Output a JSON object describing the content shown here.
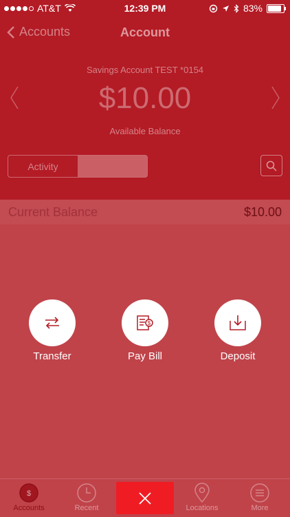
{
  "status": {
    "carrier": "AT&T",
    "time": "12:39 PM",
    "battery": "83%"
  },
  "nav": {
    "back_label": "Accounts",
    "title": "Account"
  },
  "account": {
    "name": "Savings Account TEST *0154",
    "balance": "$10.00",
    "balance_label": "Available Balance"
  },
  "segments": [
    "Activity",
    ""
  ],
  "current_balance": {
    "label": "Current Balance",
    "value": "$10.00"
  },
  "actions": [
    {
      "label": "Transfer",
      "icon": "transfer-arrows-icon"
    },
    {
      "label": "Pay Bill",
      "icon": "bill-icon"
    },
    {
      "label": "Deposit",
      "icon": "deposit-tray-icon"
    }
  ],
  "tabs": [
    {
      "label": "Accounts",
      "icon": "dollar-circle-icon",
      "active": true
    },
    {
      "label": "Recent",
      "icon": "clock-icon",
      "active": false
    },
    {
      "label": "Locations",
      "icon": "location-pin-icon",
      "active": false
    },
    {
      "label": "More",
      "icon": "menu-icon",
      "active": false
    }
  ],
  "colors": {
    "header": "#b31b25",
    "overlay": "#c0434a",
    "close": "#ef1d23",
    "accent_icon": "#b31b25"
  }
}
